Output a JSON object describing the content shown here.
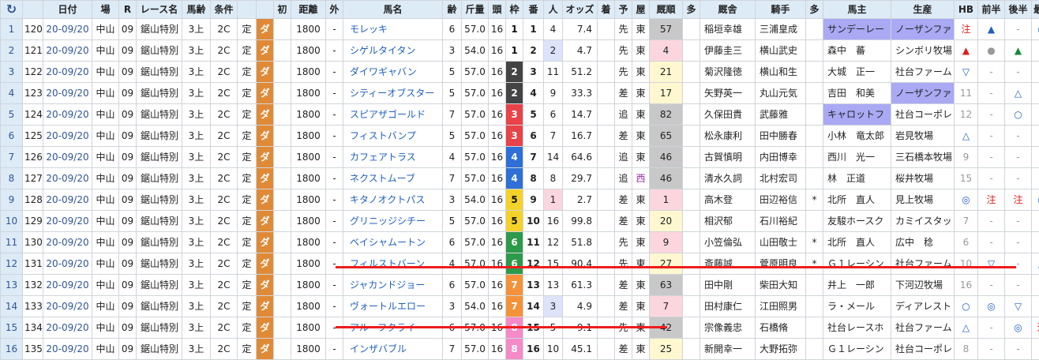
{
  "headers": {
    "refresh_icon": "↻",
    "cols": [
      "日付",
      "場",
      "R",
      "レース名",
      "馬齢",
      "条件",
      "",
      "",
      "初",
      "距離",
      "外",
      "馬名",
      "齢",
      "斤量",
      "頭",
      "枠",
      "番",
      "人",
      "オッズ",
      "着",
      "予",
      "屋",
      "厩順",
      "多",
      "厩舎",
      "騎手",
      "多",
      "馬主",
      "生産",
      "HB",
      "前半",
      "後半",
      "最H"
    ]
  },
  "rows": [
    {
      "n": "1",
      "id": "120",
      "date": "20-09/20",
      "place": "中山",
      "r": "09",
      "race": "鋸山特別",
      "age": "3上",
      "cond": "2C",
      "fix": "定",
      "surface": "ダ",
      "first": "",
      "dist": "1800",
      "out": "-",
      "horse": "モレッキ",
      "sexage": "6",
      "kin": "57.0",
      "heads": "16",
      "waku": "1",
      "ban": "1",
      "pop": "4",
      "odds": "7.4",
      "chaku": "",
      "yo": "先",
      "ya": "東",
      "kyu": "57",
      "ta": "",
      "stable": "稲垣幸雄",
      "jockey": "三浦皇成",
      "ta2": "",
      "owner": "サンデーレー",
      "breeder": "ノーザンファ",
      "hb": "注",
      "zen": "▲",
      "kou": "-",
      "sai": "○"
    },
    {
      "n": "2",
      "id": "121",
      "date": "20-09/20",
      "place": "中山",
      "r": "09",
      "race": "鋸山特別",
      "age": "3上",
      "cond": "2C",
      "fix": "定",
      "surface": "ダ",
      "first": "",
      "dist": "1800",
      "out": "-",
      "horse": "シゲルタイタン",
      "sexage": "3",
      "kin": "54.0",
      "heads": "16",
      "waku": "1",
      "ban": "2",
      "pop": "2",
      "odds": "4.7",
      "chaku": "",
      "yo": "先",
      "ya": "東",
      "kyu": "4",
      "ta": "",
      "stable": "伊藤圭三",
      "jockey": "横山武史",
      "ta2": "",
      "owner": "森中　蕃",
      "breeder": "シンボリ牧場",
      "hb": "▲",
      "zen": "●",
      "kou": "▲",
      "sai": "-"
    },
    {
      "n": "3",
      "id": "122",
      "date": "20-09/20",
      "place": "中山",
      "r": "09",
      "race": "鋸山特別",
      "age": "3上",
      "cond": "2C",
      "fix": "定",
      "surface": "ダ",
      "first": "",
      "dist": "1800",
      "out": "-",
      "horse": "ダイワギャバン",
      "sexage": "5",
      "kin": "57.0",
      "heads": "16",
      "waku": "2",
      "ban": "3",
      "pop": "11",
      "odds": "51.2",
      "chaku": "",
      "yo": "先",
      "ya": "東",
      "kyu": "21",
      "ta": "",
      "stable": "菊沢隆徳",
      "jockey": "横山和生",
      "ta2": "",
      "owner": "大城　正一",
      "breeder": "社台ファーム",
      "hb": "▽",
      "zen": "-",
      "kou": "-",
      "sai": "-"
    },
    {
      "n": "4",
      "id": "123",
      "date": "20-09/20",
      "place": "中山",
      "r": "09",
      "race": "鋸山特別",
      "age": "3上",
      "cond": "2C",
      "fix": "定",
      "surface": "ダ",
      "first": "",
      "dist": "1800",
      "out": "-",
      "horse": "シティーオブスター",
      "sexage": "5",
      "kin": "57.0",
      "heads": "16",
      "waku": "2",
      "ban": "4",
      "pop": "9",
      "odds": "33.3",
      "chaku": "",
      "yo": "差",
      "ya": "東",
      "kyu": "17",
      "ta": "",
      "stable": "矢野英一",
      "jockey": "丸山元気",
      "ta2": "",
      "owner": "吉田　和美",
      "breeder": "ノーザンファ",
      "hb": "11",
      "zen": "-",
      "kou": "△",
      "sai": "-"
    },
    {
      "n": "5",
      "id": "124",
      "date": "20-09/20",
      "place": "中山",
      "r": "09",
      "race": "鋸山特別",
      "age": "3上",
      "cond": "2C",
      "fix": "定",
      "surface": "ダ",
      "first": "",
      "dist": "1800",
      "out": "-",
      "horse": "スピアザゴールド",
      "sexage": "7",
      "kin": "57.0",
      "heads": "16",
      "waku": "3",
      "ban": "5",
      "pop": "6",
      "odds": "14.7",
      "chaku": "",
      "yo": "追",
      "ya": "東",
      "kyu": "82",
      "ta": "",
      "stable": "久保田貴",
      "jockey": "武藤雅",
      "ta2": "",
      "owner": "キャロットフ",
      "breeder": "社台コーポレ",
      "hb": "12",
      "zen": "-",
      "kou": "○",
      "sai": "-"
    },
    {
      "n": "6",
      "id": "125",
      "date": "20-09/20",
      "place": "中山",
      "r": "09",
      "race": "鋸山特別",
      "age": "3上",
      "cond": "2C",
      "fix": "定",
      "surface": "ダ",
      "first": "",
      "dist": "1800",
      "out": "-",
      "horse": "フィストバンプ",
      "sexage": "5",
      "kin": "57.0",
      "heads": "16",
      "waku": "3",
      "ban": "6",
      "pop": "7",
      "odds": "16.7",
      "chaku": "",
      "yo": "差",
      "ya": "東",
      "kyu": "65",
      "ta": "",
      "stable": "松永康利",
      "jockey": "田中勝春",
      "ta2": "",
      "owner": "小林　竜太郎",
      "breeder": "岩見牧場",
      "hb": "△",
      "zen": "-",
      "kou": "-",
      "sai": "-"
    },
    {
      "n": "7",
      "id": "126",
      "date": "20-09/20",
      "place": "中山",
      "r": "09",
      "race": "鋸山特別",
      "age": "3上",
      "cond": "2C",
      "fix": "定",
      "surface": "ダ",
      "first": "",
      "dist": "1800",
      "out": "-",
      "horse": "カフェアトラス",
      "sexage": "4",
      "kin": "57.0",
      "heads": "16",
      "waku": "4",
      "ban": "7",
      "pop": "14",
      "odds": "64.6",
      "chaku": "",
      "yo": "追",
      "ya": "東",
      "kyu": "46",
      "ta": "",
      "stable": "古賀慎明",
      "jockey": "内田博幸",
      "ta2": "",
      "owner": "西川　光一",
      "breeder": "三石橋本牧場",
      "hb": "9",
      "zen": "-",
      "kou": "-",
      "sai": "-"
    },
    {
      "n": "8",
      "id": "127",
      "date": "20-09/20",
      "place": "中山",
      "r": "09",
      "race": "鋸山特別",
      "age": "3上",
      "cond": "2C",
      "fix": "定",
      "surface": "ダ",
      "first": "",
      "dist": "1800",
      "out": "-",
      "horse": "ネクストムーブ",
      "sexage": "7",
      "kin": "57.0",
      "heads": "16",
      "waku": "4",
      "ban": "8",
      "pop": "8",
      "odds": "29.7",
      "chaku": "",
      "yo": "追",
      "ya": "西",
      "kyu": "46",
      "ta": "",
      "stable": "清水久詞",
      "jockey": "北村宏司",
      "ta2": "",
      "owner": "林　正道",
      "breeder": "桜井牧場",
      "hb": "15",
      "zen": "-",
      "kou": "-",
      "sai": "-"
    },
    {
      "n": "9",
      "id": "128",
      "date": "20-09/20",
      "place": "中山",
      "r": "09",
      "race": "鋸山特別",
      "age": "3上",
      "cond": "2C",
      "fix": "定",
      "surface": "ダ",
      "first": "",
      "dist": "1800",
      "out": "-",
      "horse": "キタノオクトパス",
      "sexage": "3",
      "kin": "54.0",
      "heads": "16",
      "waku": "5",
      "ban": "9",
      "pop": "1",
      "odds": "2.7",
      "chaku": "",
      "yo": "差",
      "ya": "東",
      "kyu": "1",
      "ta": "",
      "stable": "高木登",
      "jockey": "田辺裕信",
      "ta2": "*",
      "owner": "北所　直人",
      "breeder": "見上牧場",
      "hb": "◎",
      "zen": "注",
      "kou": "注",
      "sai": "◎"
    },
    {
      "n": "10",
      "id": "129",
      "date": "20-09/20",
      "place": "中山",
      "r": "09",
      "race": "鋸山特別",
      "age": "3上",
      "cond": "2C",
      "fix": "定",
      "surface": "ダ",
      "first": "",
      "dist": "1800",
      "out": "-",
      "horse": "グリニッジシチー",
      "sexage": "5",
      "kin": "57.0",
      "heads": "16",
      "waku": "5",
      "ban": "10",
      "pop": "16",
      "odds": "99.8",
      "chaku": "",
      "yo": "差",
      "ya": "東",
      "kyu": "20",
      "ta": "",
      "stable": "相沢郁",
      "jockey": "石川裕紀",
      "ta2": "",
      "owner": "友駿ホースク",
      "breeder": "カミイスタッ",
      "hb": "7",
      "zen": "-",
      "kou": "-",
      "sai": "-"
    },
    {
      "n": "11",
      "id": "130",
      "date": "20-09/20",
      "place": "中山",
      "r": "09",
      "race": "鋸山特別",
      "age": "3上",
      "cond": "2C",
      "fix": "定",
      "surface": "ダ",
      "first": "",
      "dist": "1800",
      "out": "-",
      "horse": "ベイシャムートン",
      "sexage": "6",
      "kin": "57.0",
      "heads": "16",
      "waku": "6",
      "ban": "11",
      "pop": "12",
      "odds": "51.8",
      "chaku": "",
      "yo": "先",
      "ya": "東",
      "kyu": "9",
      "ta": "",
      "stable": "小笠倫弘",
      "jockey": "山田敬士",
      "ta2": "*",
      "owner": "北所　直人",
      "breeder": "広中　稔",
      "hb": "6",
      "zen": "-",
      "kou": "-",
      "sai": "-"
    },
    {
      "n": "12",
      "id": "131",
      "date": "20-09/20",
      "place": "中山",
      "r": "09",
      "race": "鋸山特別",
      "age": "3上",
      "cond": "2C",
      "fix": "定",
      "surface": "ダ",
      "first": "",
      "dist": "1800",
      "out": "-",
      "horse": "フィルストバーン",
      "sexage": "4",
      "kin": "57.0",
      "heads": "16",
      "waku": "6",
      "ban": "12",
      "pop": "15",
      "odds": "90.4",
      "chaku": "",
      "yo": "先",
      "ya": "東",
      "kyu": "27",
      "ta": "",
      "stable": "斎藤誠",
      "jockey": "菅原明良",
      "ta2": "*",
      "owner": "Ｇ１レーシン",
      "breeder": "社台ファーム",
      "hb": "10",
      "zen": "▽",
      "kou": "-",
      "sai": "△"
    },
    {
      "n": "13",
      "id": "132",
      "date": "20-09/20",
      "place": "中山",
      "r": "09",
      "race": "鋸山特別",
      "age": "3上",
      "cond": "2C",
      "fix": "定",
      "surface": "ダ",
      "first": "",
      "dist": "1800",
      "out": "-",
      "horse": "ジャカンドジョー",
      "sexage": "6",
      "kin": "57.0",
      "heads": "16",
      "waku": "7",
      "ban": "13",
      "pop": "13",
      "odds": "61.3",
      "chaku": "",
      "yo": "差",
      "ya": "東",
      "kyu": "63",
      "ta": "",
      "stable": "田中剛",
      "jockey": "柴田大知",
      "ta2": "",
      "owner": "井上　一郎",
      "breeder": "下河辺牧場",
      "hb": "16",
      "zen": "-",
      "kou": "-",
      "sai": "-"
    },
    {
      "n": "14",
      "id": "133",
      "date": "20-09/20",
      "place": "中山",
      "r": "09",
      "race": "鋸山特別",
      "age": "3上",
      "cond": "2C",
      "fix": "定",
      "surface": "ダ",
      "first": "",
      "dist": "1800",
      "out": "-",
      "horse": "ヴォートルエロー",
      "sexage": "3",
      "kin": "54.0",
      "heads": "16",
      "waku": "7",
      "ban": "14",
      "pop": "3",
      "odds": "4.9",
      "chaku": "",
      "yo": "差",
      "ya": "東",
      "kyu": "7",
      "ta": "",
      "stable": "田村康仁",
      "jockey": "江田照男",
      "ta2": "",
      "owner": "ラ・メール",
      "breeder": "ディアレスト",
      "hb": "○",
      "zen": "◎",
      "kou": "▽",
      "sai": "-"
    },
    {
      "n": "15",
      "id": "134",
      "date": "20-09/20",
      "place": "中山",
      "r": "09",
      "race": "鋸山特別",
      "age": "3上",
      "cond": "2C",
      "fix": "定",
      "surface": "ダ",
      "first": "",
      "dist": "1800",
      "out": "-",
      "horse": "アルーフクライ",
      "sexage": "6",
      "kin": "57.0",
      "heads": "16",
      "waku": "8",
      "ban": "15",
      "pop": "5",
      "odds": "9.1",
      "chaku": "",
      "yo": "先",
      "ya": "東",
      "kyu": "42",
      "ta": "",
      "stable": "宗像義忠",
      "jockey": "石橋脩",
      "ta2": "",
      "owner": "社台レースホ",
      "breeder": "社台ファーム",
      "hb": "△",
      "zen": "-",
      "kou": "◎",
      "sai": "注"
    },
    {
      "n": "16",
      "id": "135",
      "date": "20-09/20",
      "place": "中山",
      "r": "09",
      "race": "鋸山特別",
      "age": "3上",
      "cond": "2C",
      "fix": "定",
      "surface": "ダ",
      "first": "",
      "dist": "1800",
      "out": "-",
      "horse": "インザバブル",
      "sexage": "7",
      "kin": "57.0",
      "heads": "16",
      "waku": "8",
      "ban": "16",
      "pop": "10",
      "odds": "45.1",
      "chaku": "",
      "yo": "差",
      "ya": "東",
      "kyu": "25",
      "ta": "",
      "stable": "新開幸一",
      "jockey": "大野拓弥",
      "ta2": "",
      "owner": "Ｇ１レーシン",
      "breeder": "社台コーポレ",
      "hb": "8",
      "zen": "-",
      "kou": "-",
      "sai": "-"
    }
  ],
  "colors": {
    "waku": {
      "1": "#ffffff",
      "2": "#444444",
      "3": "#e8424a",
      "4": "#2f6fd6",
      "5": "#f4d22a",
      "6": "#2d9a4a",
      "7": "#f4923a",
      "8": "#f48ac8"
    },
    "underline": "#ee1c1c"
  }
}
